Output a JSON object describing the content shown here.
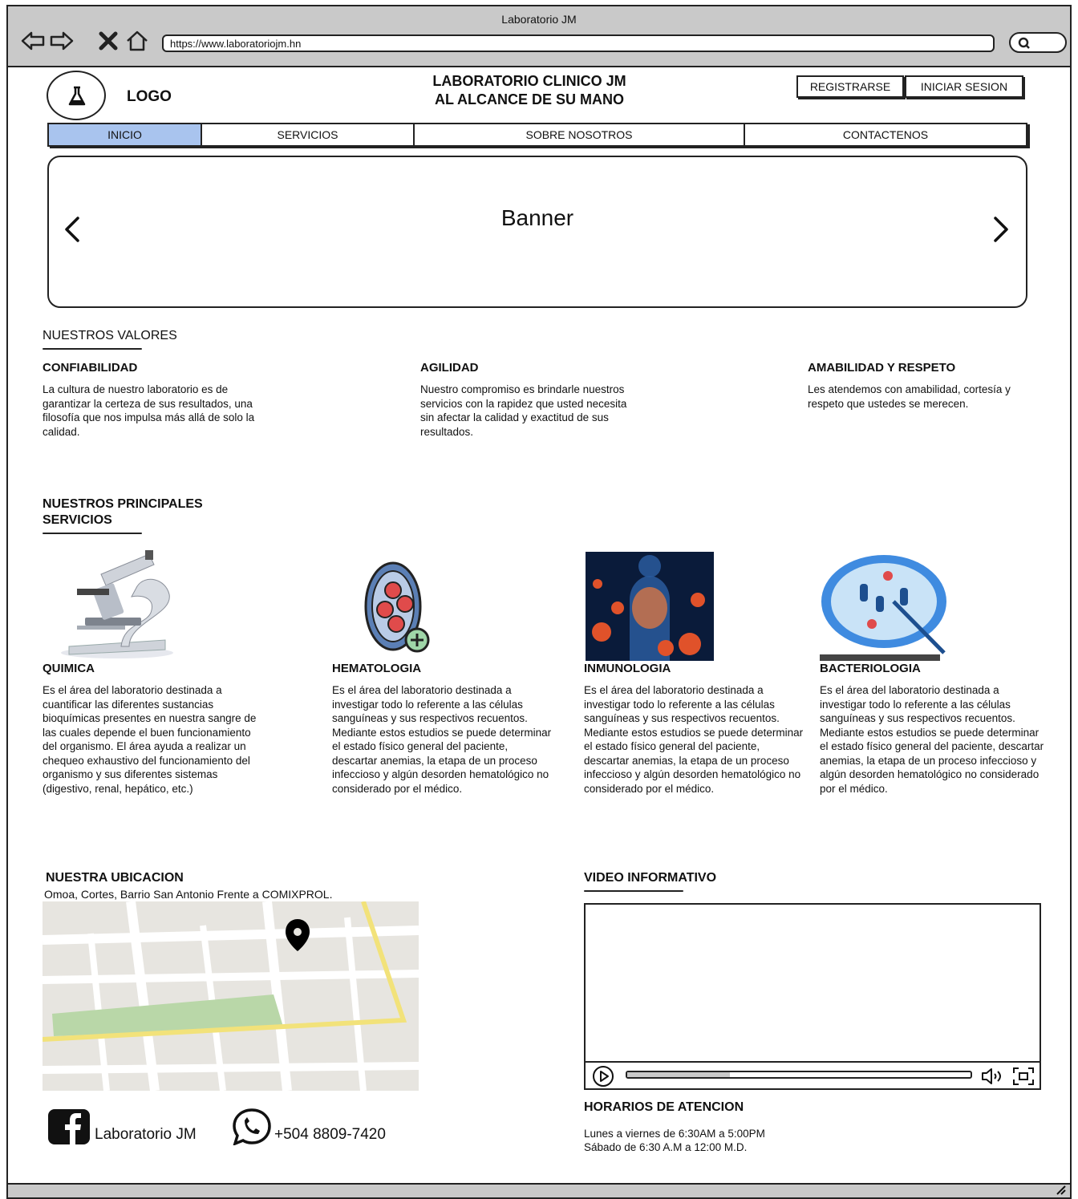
{
  "window": {
    "title": "Laboratorio JM",
    "url": "https://www.laboratoriojm.hn"
  },
  "header": {
    "logo_label": "LOGO",
    "site_title_line1": "LABORATORIO CLINICO JM",
    "site_title_line2": "AL ALCANCE DE SU MANO",
    "register_label": "REGISTRARSE",
    "login_label": "INICIAR SESION"
  },
  "nav": {
    "items": [
      {
        "label": "INICIO",
        "active": true
      },
      {
        "label": "SERVICIOS",
        "active": false
      },
      {
        "label": "SOBRE NOSOTROS",
        "active": false
      },
      {
        "label": "CONTACTENOS",
        "active": false
      }
    ]
  },
  "banner": {
    "title": "Banner"
  },
  "values": {
    "heading": "NUESTROS VALORES",
    "items": [
      {
        "title": "CONFIABILIDAD",
        "text": "La cultura de nuestro laboratorio es de garantizar la certeza de sus resultados, una filosofía que nos impulsa más allá de solo la calidad."
      },
      {
        "title": "AGILIDAD",
        "text": "Nuestro compromiso es brindarle nuestros servicios con la rapidez que usted necesita sin afectar la calidad y exactitud de sus resultados."
      },
      {
        "title": "AMABILIDAD Y RESPETO",
        "text": "Les atendemos con amabilidad, cortesía y respeto que ustedes se merecen."
      }
    ]
  },
  "services": {
    "heading_line1": "NUESTROS PRINCIPALES",
    "heading_line2": "SERVICIOS",
    "items": [
      {
        "title": "QUIMICA",
        "text": "Es el área del laboratorio destinada a cuantificar las diferentes sustancias bioquímicas presentes en nuestra sangre de las cuales depende el buen funcionamiento del organismo. El área ayuda a realizar un chequeo exhaustivo del funcionamiento del organismo y sus diferentes sistemas (digestivo, renal, hepático, etc.)"
      },
      {
        "title": "HEMATOLOGIA",
        "text": "Es el área del laboratorio destinada a investigar todo lo referente a las células sanguíneas y sus respectivos recuentos. Mediante estos estudios se puede determinar el estado físico general del paciente, descartar anemias, la etapa de un proceso infeccioso y algún desorden hematológico no considerado por el médico."
      },
      {
        "title": "INMUNOLOGIA",
        "text": "Es el área del laboratorio destinada a investigar todo lo referente a las células sanguíneas y sus respectivos recuentos. Mediante estos estudios se puede determinar el estado físico general del paciente, descartar anemias, la etapa de un proceso infeccioso y algún desorden hematológico no considerado por el médico."
      },
      {
        "title": "BACTERIOLOGIA",
        "text": "Es el área del laboratorio destinada a investigar todo lo referente a las células sanguíneas y sus respectivos recuentos. Mediante estos estudios se puede determinar el estado físico general del paciente, descartar anemias, la etapa de un proceso infeccioso y algún desorden hematológico no considerado por el médico."
      }
    ]
  },
  "location": {
    "heading": "NUESTRA UBICACION",
    "address": "Omoa, Cortes, Barrio San Antonio Frente a COMIXPROL."
  },
  "video": {
    "heading": "VIDEO INFORMATIVO",
    "progress": 0.3
  },
  "hours": {
    "heading": "HORARIOS DE ATENCION",
    "line1": "Lunes a viernes de 6:30AM a 5:00PM",
    "line2": "Sábado de 6:30 A.M a 12:00 M.D."
  },
  "social": {
    "facebook": "Laboratorio JM",
    "whatsapp": "+504 8809-7420"
  },
  "colors": {
    "active_tab": "#a9c4ee",
    "chrome": "#c9c9c9",
    "map_road_yellow": "#f2e27a",
    "map_park_green": "#b9d7a8"
  }
}
